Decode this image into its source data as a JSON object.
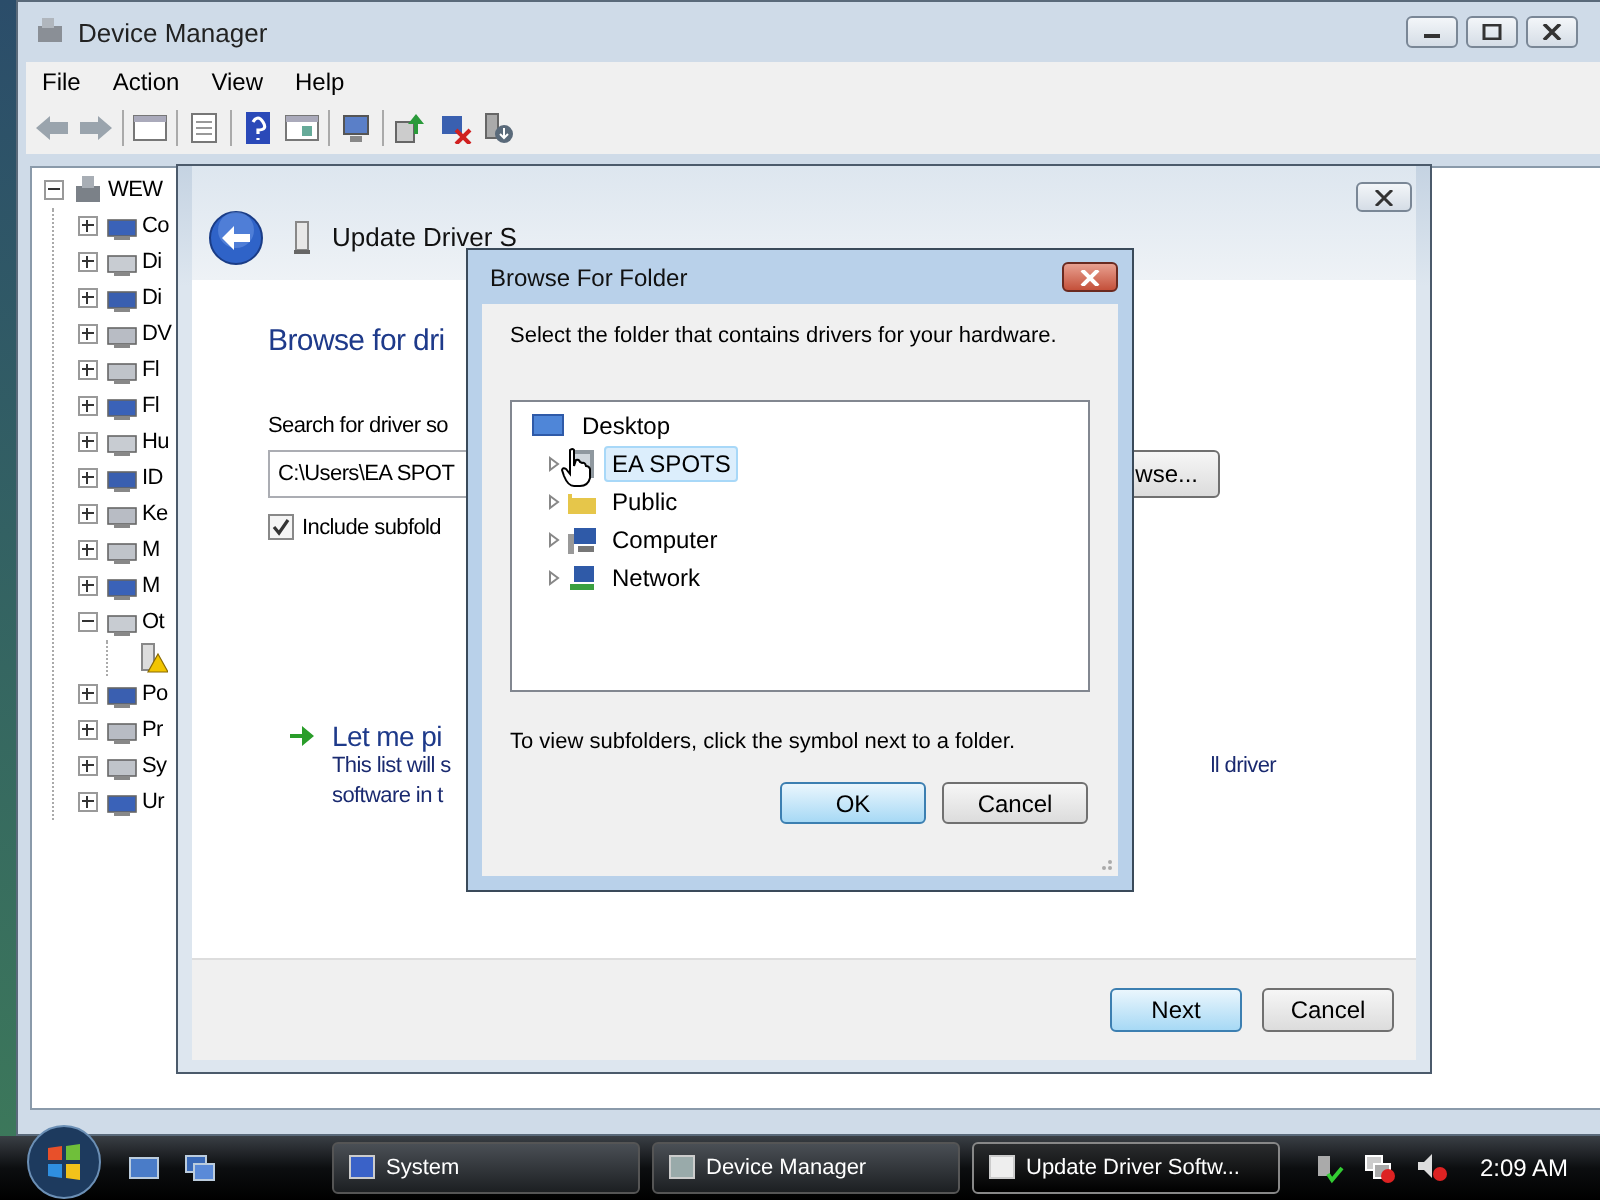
{
  "device_manager": {
    "title": "Device Manager",
    "menu": [
      "File",
      "Action",
      "View",
      "Help"
    ],
    "tree": {
      "label": "WEW",
      "expanded": true,
      "children": [
        {
          "label": "Co",
          "expanded": false
        },
        {
          "label": "Di",
          "expanded": false
        },
        {
          "label": "Di",
          "expanded": false
        },
        {
          "label": "DV",
          "expanded": false
        },
        {
          "label": "Fl",
          "expanded": false
        },
        {
          "label": "Fl",
          "expanded": false
        },
        {
          "label": "Hu",
          "expanded": false
        },
        {
          "label": "ID",
          "expanded": false
        },
        {
          "label": "Ke",
          "expanded": false
        },
        {
          "label": "M",
          "expanded": false
        },
        {
          "label": "M",
          "expanded": false
        },
        {
          "label": "Ot",
          "expanded": true,
          "children": [
            {
              "warning": true
            }
          ]
        },
        {
          "label": "Po",
          "expanded": false
        },
        {
          "label": "Pr",
          "expanded": false
        },
        {
          "label": "Sy",
          "expanded": false
        },
        {
          "label": "Ur",
          "expanded": false
        }
      ]
    }
  },
  "wizard": {
    "title": "Update Driver S",
    "heading": "Browse for dri",
    "search_label": "Search for driver so",
    "path": "C:\\Users\\EA SPOT",
    "browse_button": "wse...",
    "include_subfolders": {
      "label": "Include subfold",
      "checked": true
    },
    "option": {
      "title": "Let me pi",
      "description": [
        "This list will s",
        "software in t"
      ],
      "description_right": "ll driver"
    },
    "buttons": [
      {
        "label": "Next",
        "default": true
      },
      {
        "label": "Cancel",
        "default": false
      }
    ]
  },
  "browse_dialog": {
    "title": "Browse For Folder",
    "instruction": "Select the folder that contains drivers for your hardware.",
    "folders": [
      {
        "kind": "desktop",
        "label": "Desktop",
        "expandable": false,
        "selected": false
      },
      {
        "kind": "user",
        "label": "EA SPOTS",
        "expandable": true,
        "selected": true
      },
      {
        "kind": "folder",
        "label": "Public",
        "expandable": true,
        "selected": false
      },
      {
        "kind": "computer",
        "label": "Computer",
        "expandable": true,
        "selected": false
      },
      {
        "kind": "network",
        "label": "Network",
        "expandable": true,
        "selected": false
      }
    ],
    "hint": "To view subfolders, click the symbol next to a folder.",
    "buttons": [
      {
        "label": "OK",
        "default": true
      },
      {
        "label": "Cancel",
        "default": false
      }
    ]
  },
  "taskbar": {
    "tasks": [
      {
        "label": "System",
        "selected": false
      },
      {
        "label": "Device Manager",
        "selected": false
      },
      {
        "label": "Update Driver Softw...",
        "selected": true
      }
    ],
    "clock": "2:09 AM"
  }
}
